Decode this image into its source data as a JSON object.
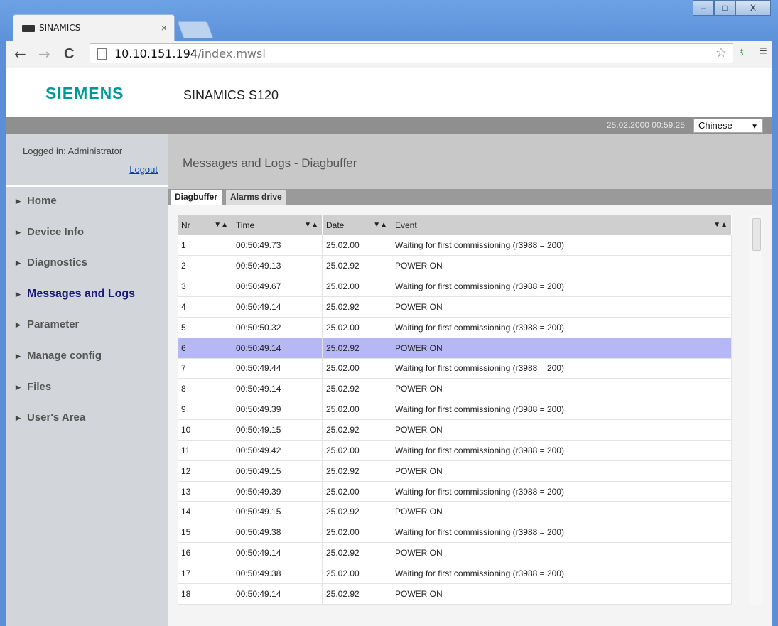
{
  "browser": {
    "tab_title": "SINAMICS",
    "tab_close": "×",
    "url_host": "10.10.151.194",
    "url_path": "/index.mwsl",
    "back_icon": "←",
    "forward_icon": "→",
    "reload_icon": "C",
    "star_icon": "☆",
    "ext_icon": "♁",
    "menu_icon": "≡",
    "window_buttons": {
      "minimize": "–",
      "maximize": "□",
      "close": "X"
    }
  },
  "header": {
    "logo": "SIEMENS",
    "product": "SINAMICS S120",
    "datetime": "25.02.2000 00:59:25",
    "language": "Chinese",
    "language_arrow": "▼"
  },
  "sidebar": {
    "logged_in": "Logged in: Administrator",
    "logout": "Logout",
    "items": [
      {
        "label": "Home"
      },
      {
        "label": "Device Info"
      },
      {
        "label": "Diagnostics"
      },
      {
        "label": "Messages and Logs"
      },
      {
        "label": "Parameter"
      },
      {
        "label": "Manage config"
      },
      {
        "label": "Files"
      },
      {
        "label": "User's Area"
      }
    ],
    "active_index": 3
  },
  "content": {
    "title": "Messages and Logs - Diagbuffer",
    "tabs": [
      "Diagbuffer",
      "Alarms drive"
    ],
    "active_tab": "Diagbuffer",
    "columns": [
      "Nr",
      "Time",
      "Date",
      "Event"
    ],
    "sort_icon": "▼▲",
    "selected_row": 6,
    "rows": [
      {
        "nr": "1",
        "time": "00:50:49.73",
        "date": "25.02.00",
        "event": "Waiting for first commissioning (r3988 = 200)"
      },
      {
        "nr": "2",
        "time": "00:50:49.13",
        "date": "25.02.92",
        "event": "POWER ON"
      },
      {
        "nr": "3",
        "time": "00:50:49.67",
        "date": "25.02.00",
        "event": "Waiting for first commissioning (r3988 = 200)"
      },
      {
        "nr": "4",
        "time": "00:50:49.14",
        "date": "25.02.92",
        "event": "POWER ON"
      },
      {
        "nr": "5",
        "time": "00:50:50.32",
        "date": "25.02.00",
        "event": "Waiting for first commissioning (r3988 = 200)"
      },
      {
        "nr": "6",
        "time": "00:50:49.14",
        "date": "25.02.92",
        "event": "POWER ON"
      },
      {
        "nr": "7",
        "time": "00:50:49.44",
        "date": "25.02.00",
        "event": "Waiting for first commissioning (r3988 = 200)"
      },
      {
        "nr": "8",
        "time": "00:50:49.14",
        "date": "25.02.92",
        "event": "POWER ON"
      },
      {
        "nr": "9",
        "time": "00:50:49.39",
        "date": "25.02.00",
        "event": "Waiting for first commissioning (r3988 = 200)"
      },
      {
        "nr": "10",
        "time": "00:50:49.15",
        "date": "25.02.92",
        "event": "POWER ON"
      },
      {
        "nr": "11",
        "time": "00:50:49.42",
        "date": "25.02.00",
        "event": "Waiting for first commissioning (r3988 = 200)"
      },
      {
        "nr": "12",
        "time": "00:50:49.15",
        "date": "25.02.92",
        "event": "POWER ON"
      },
      {
        "nr": "13",
        "time": "00:50:49.39",
        "date": "25.02.00",
        "event": "Waiting for first commissioning (r3988 = 200)"
      },
      {
        "nr": "14",
        "time": "00:50:49.15",
        "date": "25.02.92",
        "event": "POWER ON"
      },
      {
        "nr": "15",
        "time": "00:50:49.38",
        "date": "25.02.00",
        "event": "Waiting for first commissioning (r3988 = 200)"
      },
      {
        "nr": "16",
        "time": "00:50:49.14",
        "date": "25.02.92",
        "event": "POWER ON"
      },
      {
        "nr": "17",
        "time": "00:50:49.38",
        "date": "25.02.00",
        "event": "Waiting for first commissioning (r3988 = 200)"
      },
      {
        "nr": "18",
        "time": "00:50:49.14",
        "date": "25.02.92",
        "event": "POWER ON"
      }
    ]
  },
  "colors": {
    "siemens_teal": "#009999",
    "selected_row": "#b5b8f4",
    "active_nav": "#1a1a7a"
  }
}
